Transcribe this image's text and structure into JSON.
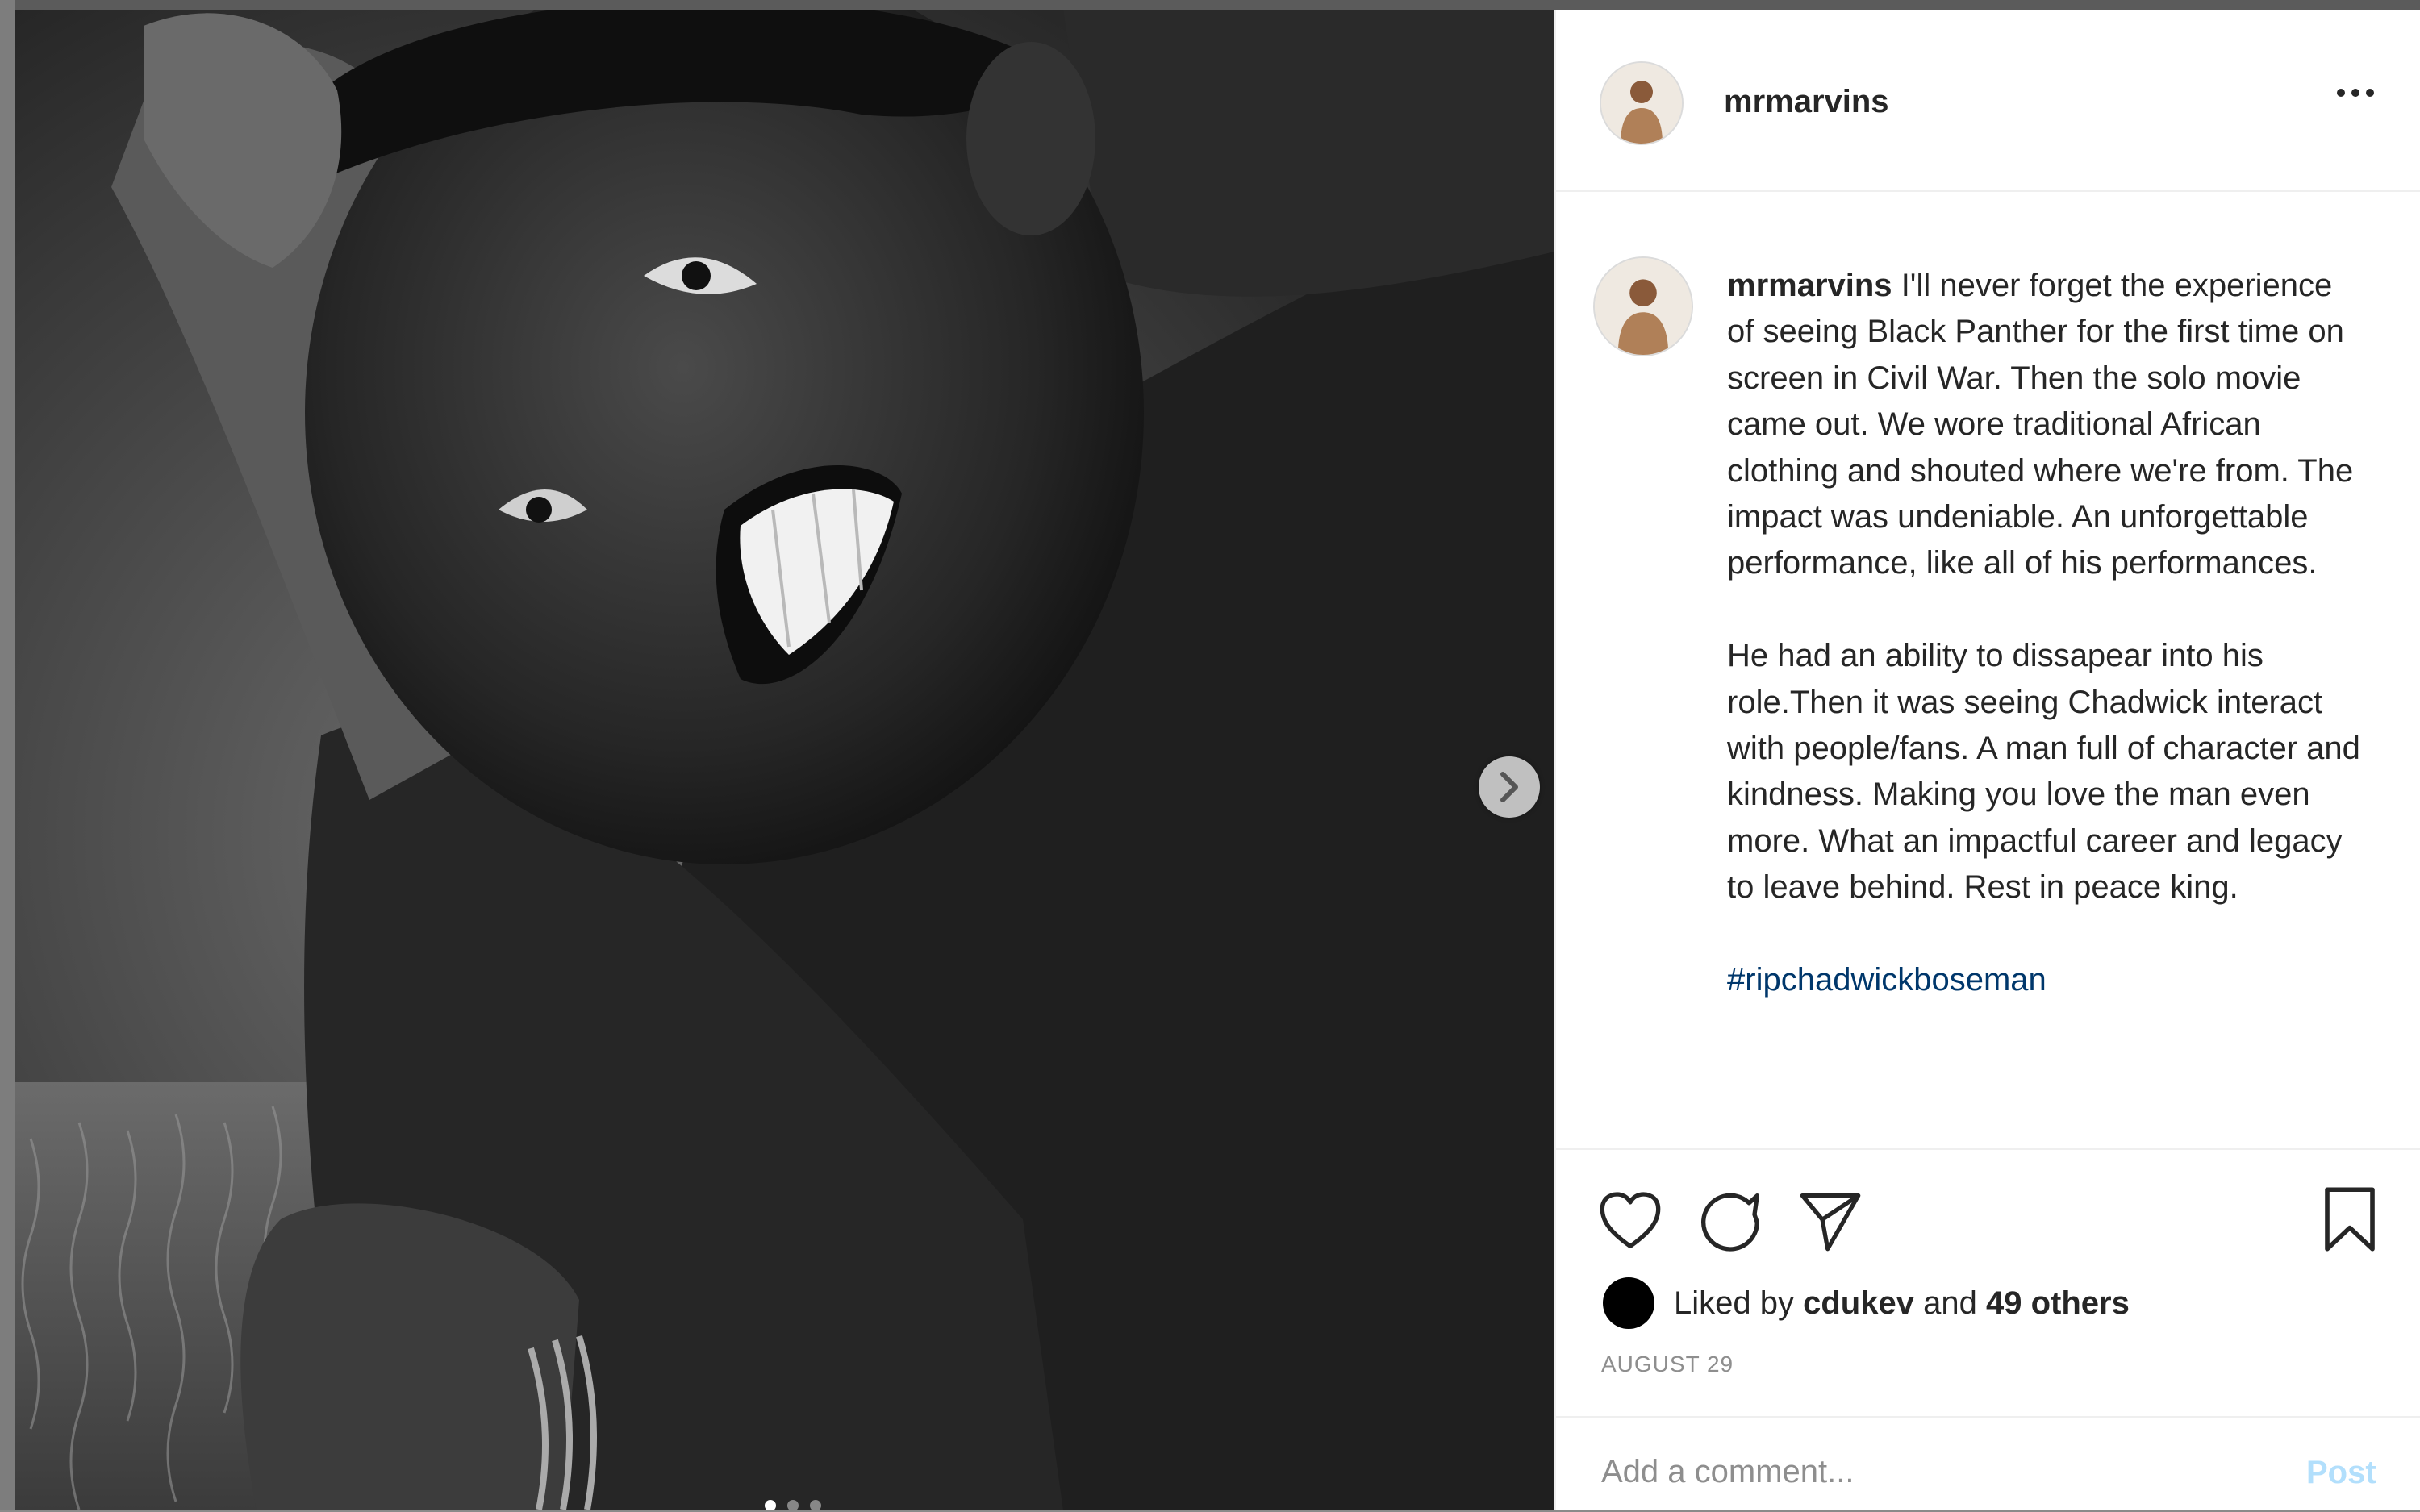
{
  "post": {
    "username": "mrmarvins",
    "caption": {
      "username": "mrmarvins",
      "paragraph1": "I'll never forget the experience of seeing Black Panther for the first time on screen in Civil War. Then the solo movie came out. We wore traditional African clothing and shouted where we're from. The impact was undeniable. An unforgettable performance, like all of his performances.",
      "paragraph2": "He had an ability to dissapear into his role.Then it was seeing Chadwick interact with people/fans. A man full of character and kindness. Making you love the man even more. What an impactful career and legacy to leave behind. Rest in peace king.",
      "hashtag": "#ripchadwickboseman"
    },
    "likes": {
      "prefix": "Liked by",
      "liker": "cdukev",
      "middle": "and",
      "others": "49 others"
    },
    "date": "AUGUST 29",
    "comment": {
      "placeholder": "Add a comment...",
      "post_label": "Post"
    },
    "carousel": {
      "slide_count": 3,
      "active_index": 0
    }
  },
  "colors": {
    "hashtag": "#00376b",
    "post_button_disabled": "#b2dffc",
    "secondary_text": "#8e8e8e",
    "primary_text": "#262626"
  },
  "icons": [
    "more-options-icon",
    "heart-icon",
    "comment-icon",
    "share-icon",
    "bookmark-icon",
    "chevron-right-icon"
  ]
}
